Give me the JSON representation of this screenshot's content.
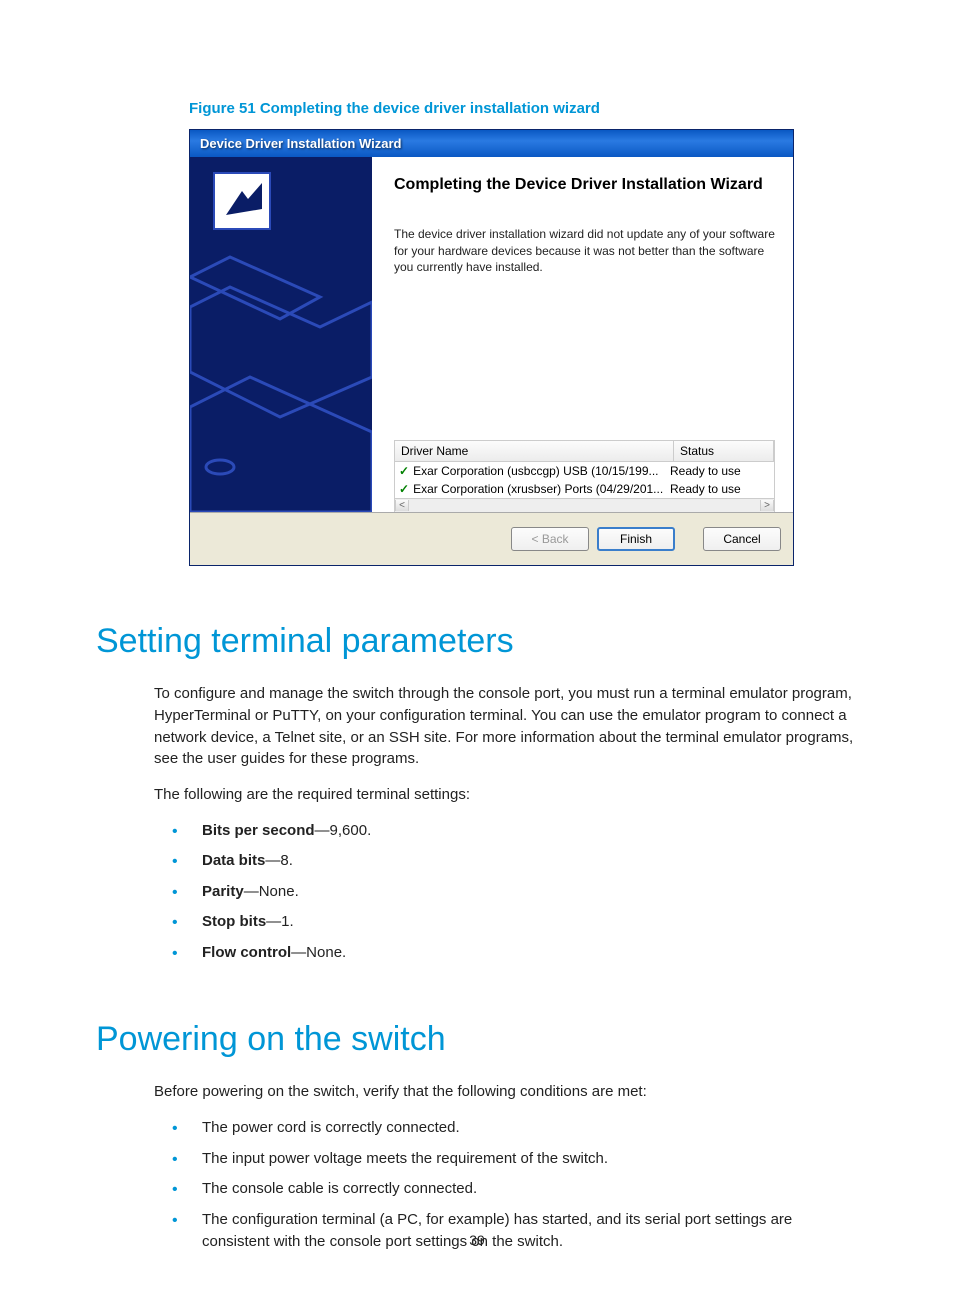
{
  "figure": {
    "caption": "Figure 51 Completing the device driver installation wizard"
  },
  "wizard": {
    "title": "Device Driver Installation Wizard",
    "heading": "Completing the Device Driver Installation Wizard",
    "body_text": "The device driver installation wizard did not update any of your software for your hardware devices because it was not better than the software you currently have installed.",
    "table": {
      "col_name": "Driver Name",
      "col_status": "Status",
      "rows": [
        {
          "name": "Exar Corporation (usbccgp) USB  (10/15/199...",
          "status": "Ready to use"
        },
        {
          "name": "Exar Corporation (xrusbser) Ports  (04/29/201...",
          "status": "Ready to use"
        }
      ]
    },
    "buttons": {
      "back": "< Back",
      "finish": "Finish",
      "cancel": "Cancel"
    }
  },
  "section1": {
    "heading": "Setting terminal parameters",
    "para1": "To configure and manage the switch through the console port, you must run a terminal emulator program, HyperTerminal or PuTTY, on your configuration terminal. You can use the emulator program to connect a network device, a Telnet site, or an SSH site. For more information about the terminal emulator programs, see the user guides for these programs.",
    "para2": "The following are the required terminal settings:",
    "bullets": [
      {
        "label": "Bits per second",
        "value": "—9,600."
      },
      {
        "label": "Data bits",
        "value": "—8."
      },
      {
        "label": "Parity",
        "value": "—None."
      },
      {
        "label": "Stop bits",
        "value": "—1."
      },
      {
        "label": "Flow control",
        "value": "—None."
      }
    ]
  },
  "section2": {
    "heading": "Powering on the switch",
    "para1": "Before powering on the switch, verify that the following conditions are met:",
    "bullets": [
      "The power cord is correctly connected.",
      "The input power voltage meets the requirement of the switch.",
      "The console cable is correctly connected.",
      "The configuration terminal (a PC, for example) has started, and its serial port settings are consistent with the console port settings on the switch."
    ]
  },
  "page_number": "39"
}
